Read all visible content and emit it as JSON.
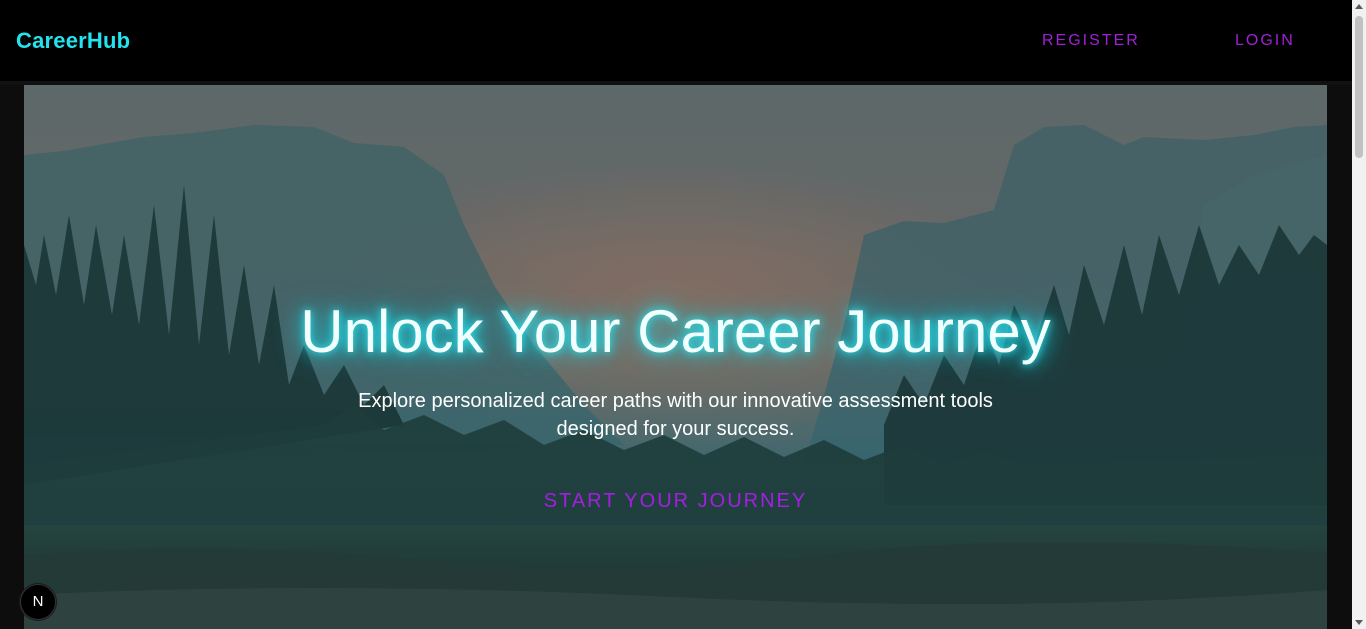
{
  "navbar": {
    "brand": "CareerHub",
    "links": [
      {
        "label": "REGISTER"
      },
      {
        "label": "LOGIN"
      }
    ]
  },
  "hero": {
    "title": "Unlock Your Career Journey",
    "subtitle": "Explore personalized career paths with our innovative assessment tools designed for your success.",
    "cta_label": "START YOUR JOURNEY",
    "background_image": "misty mountain valley with pine forest and river"
  },
  "dev_badge": {
    "label": "N",
    "icon": "nextjs-dev-indicator-icon"
  },
  "colors": {
    "brand": "#22e3ee",
    "nav_link": "#a020d8",
    "cta": "#a41ee0",
    "title_glow": "#19d6e6",
    "navbar_bg": "#000000"
  }
}
